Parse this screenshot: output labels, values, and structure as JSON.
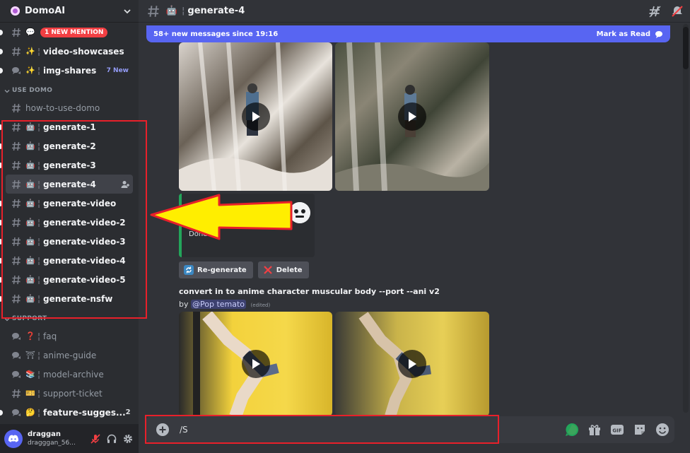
{
  "server": {
    "name": "DomoAI"
  },
  "channels_top": [
    {
      "key": "mention",
      "emoji": "💬",
      "label": "",
      "badge_mention": "1 NEW MENTION"
    },
    {
      "key": "video-showcases",
      "emoji": "✨",
      "label": "video-showcases"
    },
    {
      "key": "img-shares",
      "emoji": "✨",
      "label": "img-shares",
      "badge_new": "7 New",
      "forum": true
    }
  ],
  "categories": {
    "use_domo": "USE DOMO",
    "support": "SUPPORT"
  },
  "use_domo_channels": [
    {
      "label": "how-to-use-domo",
      "dim": true
    },
    {
      "label": "generate-1",
      "emoji": "🤖"
    },
    {
      "label": "generate-2",
      "emoji": "🤖"
    },
    {
      "label": "generate-3",
      "emoji": "🤖"
    },
    {
      "label": "generate-4",
      "emoji": "🤖",
      "active": true
    },
    {
      "label": "generate-video",
      "emoji": "🤖"
    },
    {
      "label": "generate-video-2",
      "emoji": "🤖"
    },
    {
      "label": "generate-video-3",
      "emoji": "🤖"
    },
    {
      "label": "generate-video-4",
      "emoji": "🤖"
    },
    {
      "label": "generate-video-5",
      "emoji": "🤖"
    },
    {
      "label": "generate-nsfw",
      "emoji": "🤖"
    }
  ],
  "support_channels": [
    {
      "label": "faq",
      "emoji": "❓",
      "forum": true,
      "dim": true
    },
    {
      "label": "anime-guide",
      "emoji": "⛩",
      "forum": true,
      "dim": true
    },
    {
      "label": "model-archive",
      "emoji": "📚",
      "forum": true,
      "dim": true
    },
    {
      "label": "support-ticket",
      "emoji": "🎫",
      "dim": true
    },
    {
      "label": "feature-sugges...",
      "emoji": "🤔",
      "forum": true,
      "count": "2"
    }
  ],
  "user": {
    "name": "draggan",
    "tag": "dragggan_56..."
  },
  "topbar": {
    "emoji": "🤖",
    "title": "generate-4"
  },
  "new_messages": {
    "text": "58+ new messages since 19:16",
    "mark_label": "Mark as Read"
  },
  "embed": {
    "done_text": "Done!"
  },
  "buttons": {
    "regenerate": "Re-generate",
    "delete": "Delete"
  },
  "message": {
    "prompt": "convert in to anime character muscular body --port --ani v2",
    "by": "by",
    "mention": "@Pop temato",
    "edited": "(edited)"
  },
  "composer": {
    "value": "/S"
  },
  "colors": {
    "accent": "#5865f2",
    "highlight": "#e8202a",
    "arrow": "#ffee00",
    "success": "#23a55a"
  }
}
